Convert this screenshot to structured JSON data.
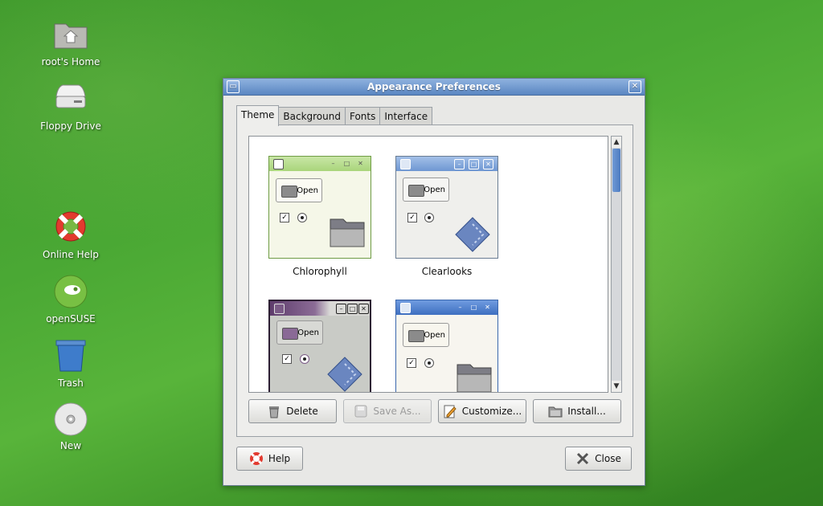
{
  "desktop": {
    "icons": [
      {
        "label": "root's Home"
      },
      {
        "label": "Floppy Drive"
      },
      {
        "label": "Online Help"
      },
      {
        "label": "openSUSE"
      },
      {
        "label": "Trash"
      },
      {
        "label": "New"
      }
    ]
  },
  "window": {
    "title": "Appearance Preferences",
    "close_glyph": "✕",
    "menu_glyph": "▭",
    "tabs": [
      {
        "label": "Theme",
        "active": true
      },
      {
        "label": "Background",
        "active": false
      },
      {
        "label": "Fonts",
        "active": false
      },
      {
        "label": "Interface",
        "active": false
      }
    ],
    "themes": [
      {
        "name": "Chlorophyll",
        "open_label": "Open"
      },
      {
        "name": "Clearlooks",
        "open_label": "Open"
      },
      {
        "name": "",
        "open_label": "Open"
      },
      {
        "name": "",
        "open_label": "Open"
      }
    ],
    "scrollbar": {
      "up_glyph": "▲",
      "down_glyph": "▼"
    },
    "actions": {
      "delete_label": "Delete",
      "save_as_label": "Save As...",
      "customize_label": "Customize...",
      "install_label": "Install..."
    },
    "footer": {
      "help_label": "Help",
      "close_label": "Close"
    }
  },
  "colors": {
    "titlebar": "#5a86c2",
    "chlorophyll_bar": "#a9d57b",
    "clearlooks_bar": "#6e97d2",
    "purple_bar": "#5e3c6c",
    "desktop_green": "#4aa834"
  }
}
